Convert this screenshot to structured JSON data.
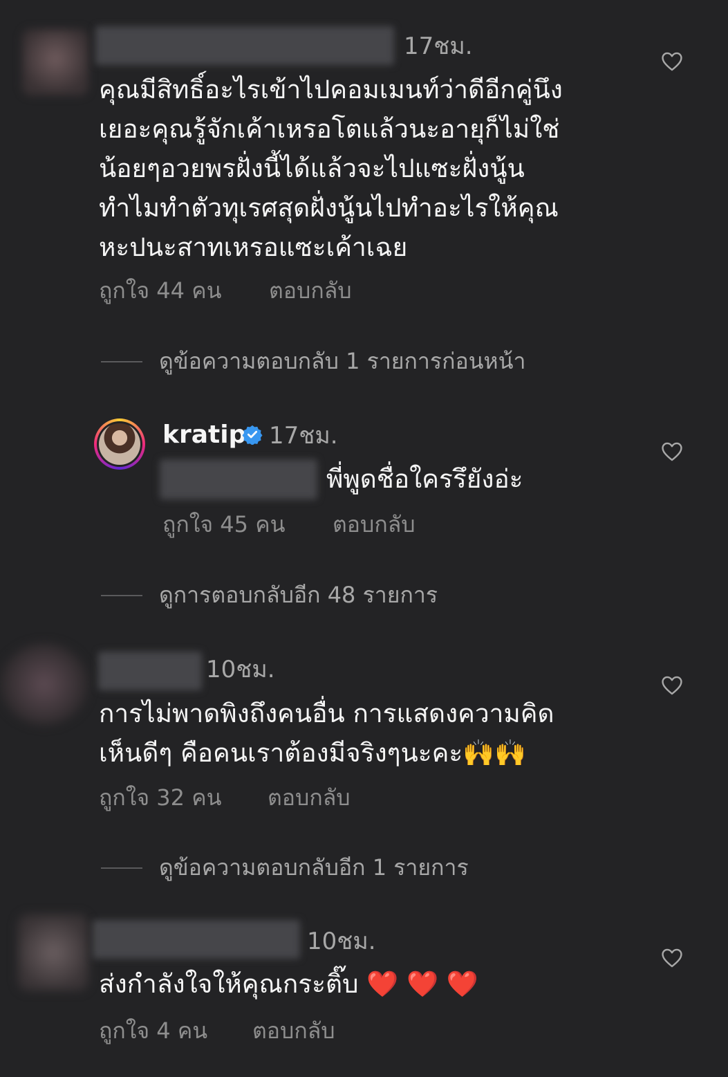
{
  "comments": [
    {
      "time": "17ชม.",
      "text": "คุณมีสิทธิ์อะไรเข้าไปคอมเมนท์ว่าดีอีกคู่นึง\nเยอะคุณรู้จักเค้าเหรอโตแล้วนะอายุก็ไม่ใช่\nน้อยๆอวยพรฝั่งนี้ได้แล้วจะไปแซะฝั่งนู้น\nทำไมทำตัวทุเรศสุดฝั่งนู้นไปทำอะไรให้คุณ\nหะปนะสาทเหรอแซะเค้าเฉย",
      "likes": "ถูกใจ 44 คน",
      "reply": "ตอบกลับ",
      "view_replies": "ดูข้อความตอบกลับ 1 รายการก่อนหน้า"
    },
    {
      "username": "kratip",
      "verified_icon": "verified-badge-icon",
      "time": "17ชม.",
      "text": "พี่พูดชื่อใครรึยังอ่ะ",
      "likes": "ถูกใจ 45 คน",
      "reply": "ตอบกลับ",
      "view_replies": "ดูการตอบกลับอีก 48 รายการ"
    },
    {
      "time": "10ชม.",
      "text": "การไม่พาดพิงถึงคนอื่น  การแสดงความคิด\nเห็นดีๆ คือคนเราต้องมีจริงๆนะคะ🙌🙌",
      "likes": "ถูกใจ 32 คน",
      "reply": "ตอบกลับ",
      "view_replies": "ดูข้อความตอบกลับอีก 1 รายการ"
    },
    {
      "time": "10ชม.",
      "text": "ส่งกำลังใจให้คุณกระติ๊บ ❤️ ❤️ ❤️",
      "likes": "ถูกใจ 4 คน",
      "reply": "ตอบกลับ"
    }
  ],
  "colors": {
    "background": "#232325",
    "text": "#f5f5f5",
    "muted": "#8e8e8e",
    "verified": "#3897f0"
  },
  "icons": {
    "like": "heart-outline-icon",
    "verified": "verified-badge-icon"
  }
}
